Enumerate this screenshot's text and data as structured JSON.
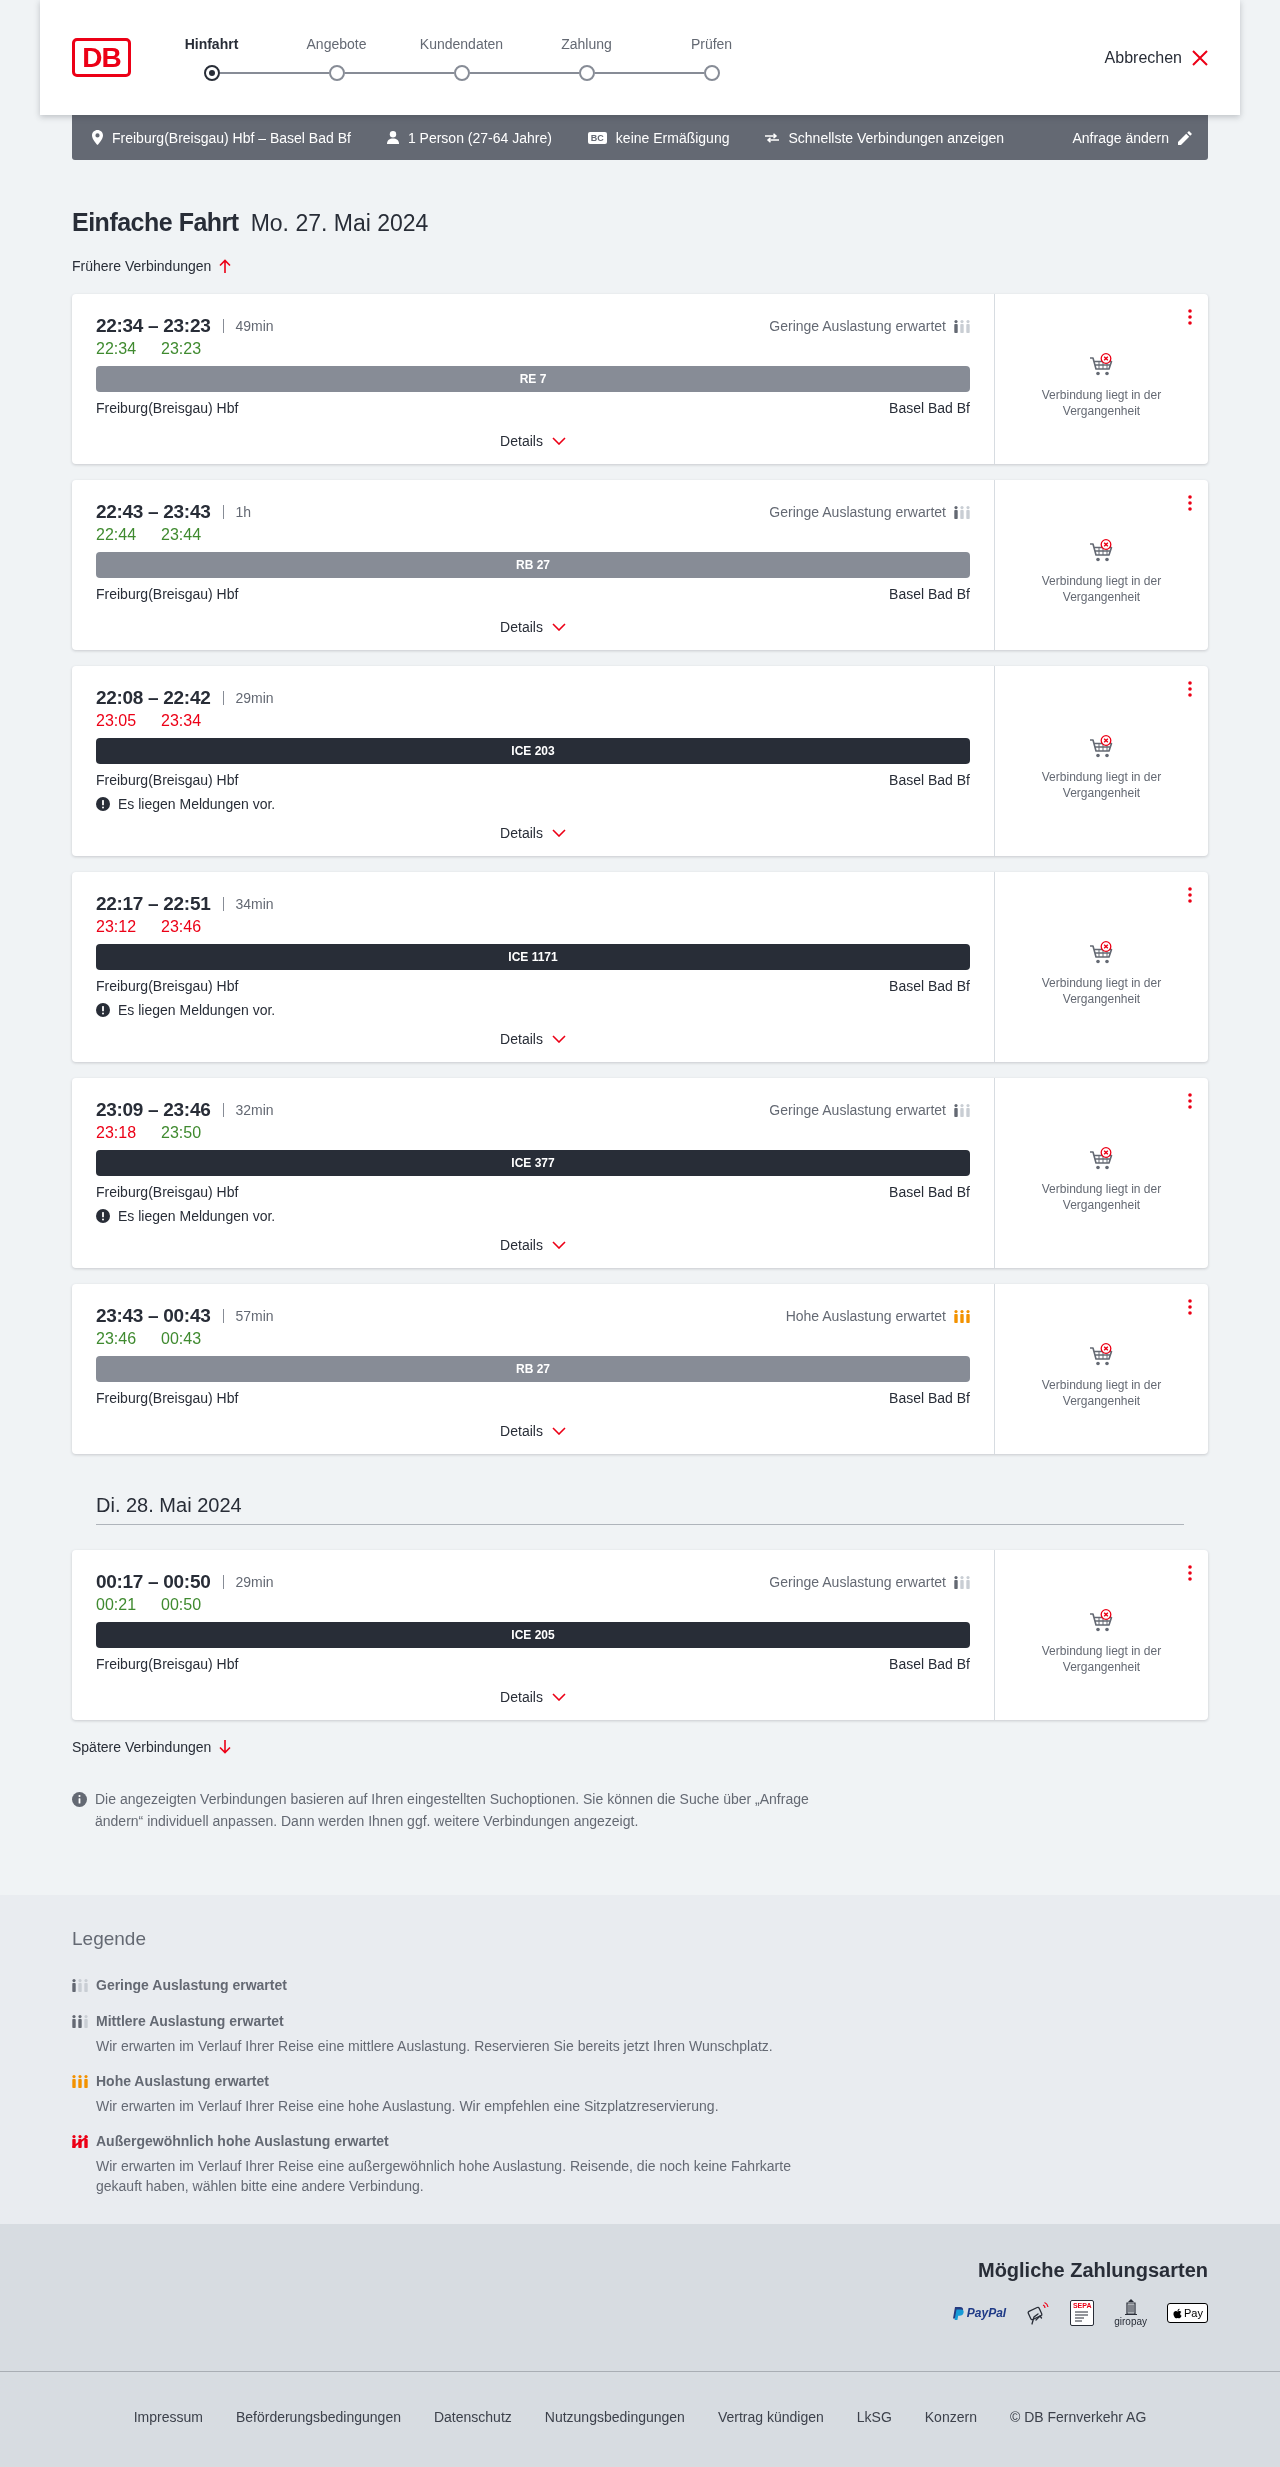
{
  "header": {
    "logo": "DB",
    "steps": [
      {
        "label": "Hinfahrt",
        "selected": true
      },
      {
        "label": "Angebote",
        "selected": false
      },
      {
        "label": "Kundendaten",
        "selected": false
      },
      {
        "label": "Zahlung",
        "selected": false
      },
      {
        "label": "Prüfen",
        "selected": false
      }
    ],
    "cancel": "Abbrechen"
  },
  "search_summary": {
    "route": "Freiburg(Breisgau) Hbf – Basel Bad Bf",
    "passengers": "1 Person (27-64 Jahre)",
    "card_badge": "BC",
    "discount": "keine Ermäßigung",
    "option": "Schnellste Verbindungen anzeigen",
    "edit": "Anfrage ändern"
  },
  "heading": {
    "title": "Einfache Fahrt",
    "date": "Mo. 27. Mai 2024"
  },
  "earlier_link": "Frühere Verbindungen",
  "results": [
    {
      "kind": "connection",
      "times": "22:34 – 23:23",
      "duration": "49min",
      "realtime": [
        {
          "time": "22:34",
          "delayed": false
        },
        {
          "time": "23:23",
          "delayed": false
        }
      ],
      "occupancy": {
        "label": "Geringe Auslastung erwartet",
        "kind": "low"
      },
      "train": {
        "name": "RE 7",
        "kind": "regional"
      },
      "from": "Freiburg(Breisgau) Hbf",
      "to": "Basel Bad Bf",
      "details": "Details",
      "status": "Verbindung liegt in der Vergangenheit"
    },
    {
      "kind": "connection",
      "times": "22:43 – 23:43",
      "duration": "1h",
      "realtime": [
        {
          "time": "22:44",
          "delayed": false
        },
        {
          "time": "23:44",
          "delayed": false
        }
      ],
      "occupancy": {
        "label": "Geringe Auslastung erwartet",
        "kind": "low"
      },
      "train": {
        "name": "RB 27",
        "kind": "regional"
      },
      "from": "Freiburg(Breisgau) Hbf",
      "to": "Basel Bad Bf",
      "details": "Details",
      "status": "Verbindung liegt in der Vergangenheit"
    },
    {
      "kind": "connection",
      "times": "22:08 – 22:42",
      "duration": "29min",
      "realtime": [
        {
          "time": "23:05",
          "delayed": true
        },
        {
          "time": "23:34",
          "delayed": true
        }
      ],
      "train": {
        "name": "ICE 203",
        "kind": "long_distance"
      },
      "from": "Freiburg(Breisgau) Hbf",
      "to": "Basel Bad Bf",
      "notice": "Es liegen Meldungen vor.",
      "details": "Details",
      "status": "Verbindung liegt in der Vergangenheit"
    },
    {
      "kind": "connection",
      "times": "22:17 – 22:51",
      "duration": "34min",
      "realtime": [
        {
          "time": "23:12",
          "delayed": true
        },
        {
          "time": "23:46",
          "delayed": true
        }
      ],
      "train": {
        "name": "ICE 1171",
        "kind": "long_distance"
      },
      "from": "Freiburg(Breisgau) Hbf",
      "to": "Basel Bad Bf",
      "notice": "Es liegen Meldungen vor.",
      "details": "Details",
      "status": "Verbindung liegt in der Vergangenheit"
    },
    {
      "kind": "connection",
      "times": "23:09 – 23:46",
      "duration": "32min",
      "realtime": [
        {
          "time": "23:18",
          "delayed": true
        },
        {
          "time": "23:50",
          "delayed": false
        }
      ],
      "occupancy": {
        "label": "Geringe Auslastung erwartet",
        "kind": "low"
      },
      "train": {
        "name": "ICE 377",
        "kind": "long_distance"
      },
      "from": "Freiburg(Breisgau) Hbf",
      "to": "Basel Bad Bf",
      "notice": "Es liegen Meldungen vor.",
      "details": "Details",
      "status": "Verbindung liegt in der Vergangenheit"
    },
    {
      "kind": "connection",
      "times": "23:43 – 00:43",
      "duration": "57min",
      "realtime": [
        {
          "time": "23:46",
          "delayed": false
        },
        {
          "time": "00:43",
          "delayed": false
        }
      ],
      "occupancy": {
        "label": "Hohe Auslastung erwartet",
        "kind": "high"
      },
      "train": {
        "name": "RB 27",
        "kind": "regional"
      },
      "from": "Freiburg(Breisgau) Hbf",
      "to": "Basel Bad Bf",
      "details": "Details",
      "status": "Verbindung liegt in der Vergangenheit"
    },
    {
      "kind": "day",
      "label": "Di. 28. Mai 2024"
    },
    {
      "kind": "connection",
      "times": "00:17 – 00:50",
      "duration": "29min",
      "realtime": [
        {
          "time": "00:21",
          "delayed": false
        },
        {
          "time": "00:50",
          "delayed": false
        }
      ],
      "occupancy": {
        "label": "Geringe Auslastung erwartet",
        "kind": "low"
      },
      "train": {
        "name": "ICE 205",
        "kind": "long_distance"
      },
      "from": "Freiburg(Breisgau) Hbf",
      "to": "Basel Bad Bf",
      "details": "Details",
      "status": "Verbindung liegt in der Vergangenheit"
    }
  ],
  "later_link": "Spätere Verbindungen",
  "info_note": "Die angezeigten Verbindungen basieren auf Ihren eingestellten Suchoptionen. Sie können die Suche über „Anfrage ändern“ individuell anpassen. Dann werden Ihnen ggf. weitere Verbindungen angezeigt.",
  "legend": {
    "title": "Legende",
    "items": [
      {
        "kind": "low",
        "title": "Geringe Auslastung erwartet"
      },
      {
        "kind": "medium",
        "title": "Mittlere Auslastung erwartet",
        "description": "Wir erwarten im Verlauf Ihrer Reise eine mittlere Auslastung. Reservieren Sie bereits jetzt Ihren Wunschplatz."
      },
      {
        "kind": "high",
        "title": "Hohe Auslastung erwartet",
        "description": "Wir erwarten im Verlauf Ihrer Reise eine hohe Auslastung. Wir empfehlen eine Sitzplatzreservierung."
      },
      {
        "kind": "extreme",
        "title": "Außergewöhnlich hohe Auslastung erwartet",
        "description": "Wir erwarten im Verlauf Ihrer Reise eine außergewöhnlich hohe Auslastung. Reisende, die noch keine Fahrkarte gekauft haben, wählen bitte eine andere Verbindung."
      }
    ]
  },
  "payment": {
    "title": "Mögliche Zahlungsarten",
    "methods": [
      {
        "kind": "paypal",
        "label": "PayPal"
      },
      {
        "kind": "contactless"
      },
      {
        "kind": "sepa",
        "label": "SEPA"
      },
      {
        "kind": "giropay",
        "label": "giropay"
      },
      {
        "kind": "applepay",
        "label": "Pay"
      }
    ]
  },
  "footer": {
    "links": [
      "Impressum",
      "Beförderungsbedingungen",
      "Datenschutz",
      "Nutzungsbedingungen",
      "Vertrag kündigen",
      "LkSG",
      "Konzern",
      "© DB Fernverkehr AG"
    ]
  }
}
